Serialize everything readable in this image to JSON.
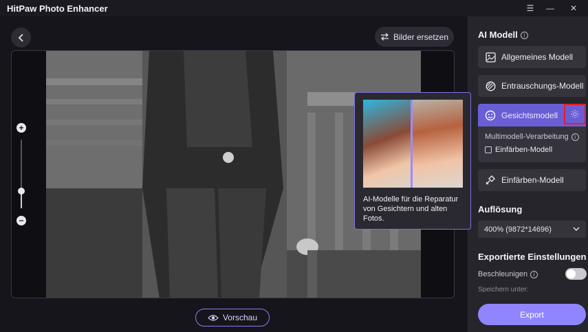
{
  "app": {
    "title": "HitPaw Photo Enhancer"
  },
  "toolbar": {
    "replace_label": "Bilder ersetzen"
  },
  "zoom": {
    "level_fraction": 0.25
  },
  "preview": {
    "label": "Vorschau"
  },
  "tooltip": {
    "text": "AI-Modelle für die Reparatur von Gesichtern und alten Fotos."
  },
  "panel": {
    "ai_model_title": "AI Modell",
    "models": [
      {
        "label": "Allgemeines Modell",
        "icon": "image-icon"
      },
      {
        "label": "Entrauschungs-Modell",
        "icon": "denoise-icon"
      },
      {
        "label": "Gesichtsmodell",
        "icon": "face-icon"
      },
      {
        "label": "Einfärben-Modell",
        "icon": "colorize-icon"
      }
    ],
    "multimodel_label": "Multimodell-Verarbeitung",
    "multimodel_option": "Einfärben-Modell",
    "resolution_title": "Auflösung",
    "resolution_value": "400% (9872*14696)",
    "export_settings_title": "Exportierte Einstellungen",
    "accelerate_label": "Beschleunigen",
    "save_label": "Speichern unter:",
    "export_label": "Export"
  },
  "colors": {
    "accent": "#8f86ff",
    "active_card": "#6a5ed6",
    "highlight_box": "#e0202a"
  }
}
